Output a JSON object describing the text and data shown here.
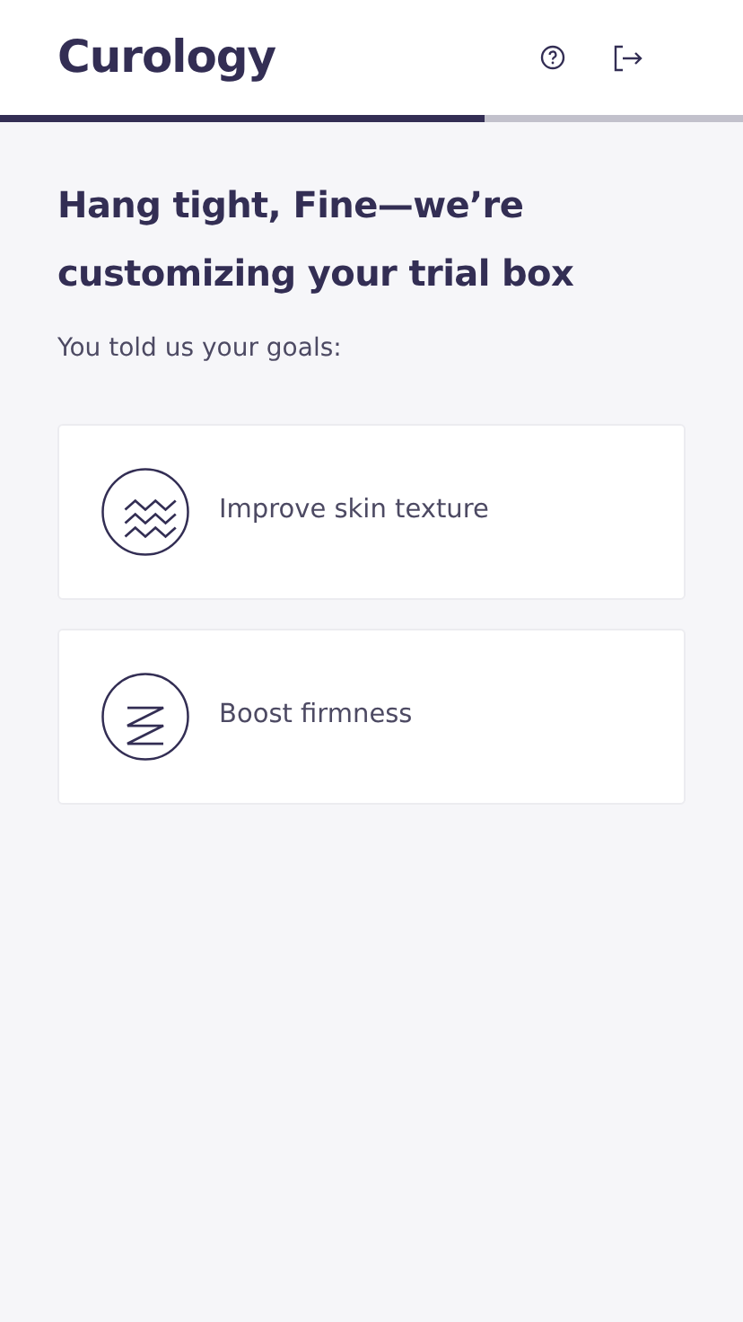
{
  "header": {
    "logo": "Curology"
  },
  "progress": {
    "level": 0.652
  },
  "heading": "Hang tight, Fine—we’re customizing your trial box",
  "subheading": "You told us your goals:",
  "goals": [
    {
      "kind": "waves",
      "label": "Improve skin texture"
    },
    {
      "kind": "zigzag",
      "label": "Boost firmness"
    }
  ]
}
